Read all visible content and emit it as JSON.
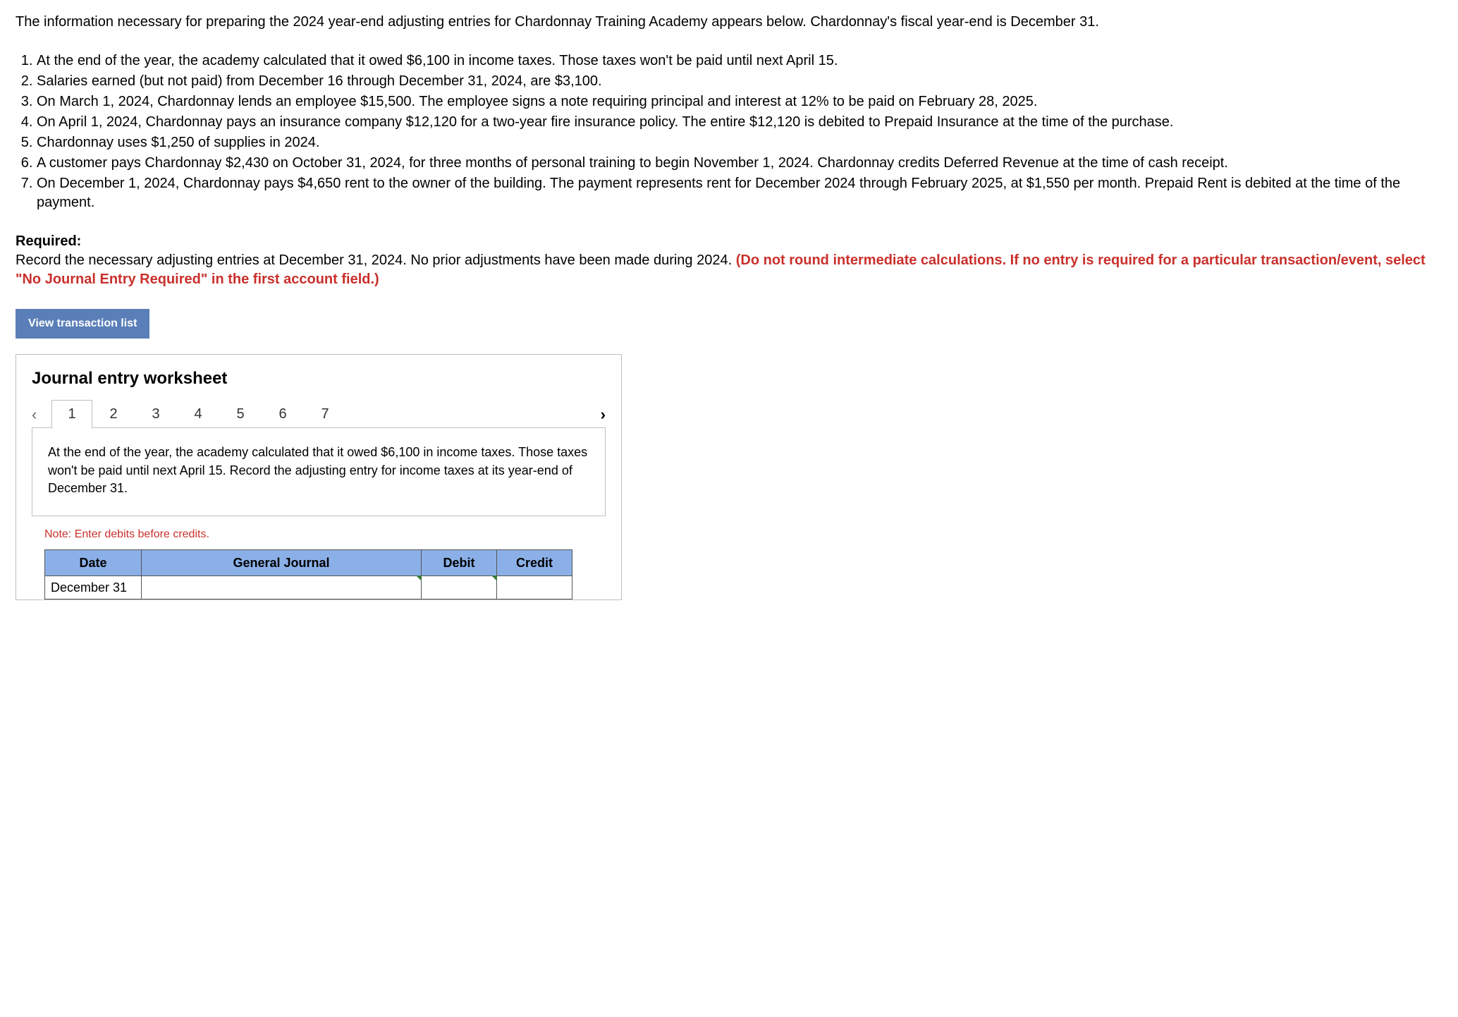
{
  "intro": "The information necessary for preparing the 2024 year-end adjusting entries for Chardonnay Training Academy appears below. Chardonnay's fiscal year-end is December 31.",
  "list_items": [
    "At the end of the year, the academy calculated that it owed $6,100 in income taxes. Those taxes won't be paid until next April 15.",
    "Salaries earned (but not paid) from December 16 through December 31, 2024, are $3,100.",
    "On March 1, 2024, Chardonnay lends an employee $15,500. The employee signs a note requiring principal and interest at 12% to be paid on February 28, 2025.",
    "On April 1, 2024, Chardonnay pays an insurance company $12,120 for a two-year fire insurance policy. The entire $12,120 is debited to Prepaid Insurance at the time of the purchase.",
    "Chardonnay uses $1,250 of supplies in 2024.",
    "A customer pays Chardonnay $2,430 on October 31, 2024, for three months of personal training to begin November 1, 2024. Chardonnay credits Deferred Revenue at the time of cash receipt.",
    "On December 1, 2024, Chardonnay pays $4,650 rent to the owner of the building. The payment represents rent for December 2024 through February 2025, at $1,550 per month. Prepaid Rent is debited at the time of the payment."
  ],
  "required": {
    "label": "Required:",
    "text_plain": "Record the necessary adjusting entries at December 31, 2024. No prior adjustments have been made during 2024. ",
    "text_red": "(Do not round intermediate calculations. If no entry is required for a particular transaction/event, select \"No Journal Entry Required\" in the first account field.)"
  },
  "button_view": "View transaction list",
  "worksheet": {
    "title": "Journal entry worksheet",
    "tabs": [
      "1",
      "2",
      "3",
      "4",
      "5",
      "6",
      "7"
    ],
    "active_tab_index": 0,
    "description": "At the end of the year, the academy calculated that it owed $6,100 in income taxes. Those taxes won't be paid until next April 15. Record the adjusting entry for income taxes at its year-end of December 31.",
    "note": "Note: Enter debits before credits.",
    "headers": {
      "date": "Date",
      "gj": "General Journal",
      "debit": "Debit",
      "credit": "Credit"
    },
    "row_date": "December 31"
  }
}
